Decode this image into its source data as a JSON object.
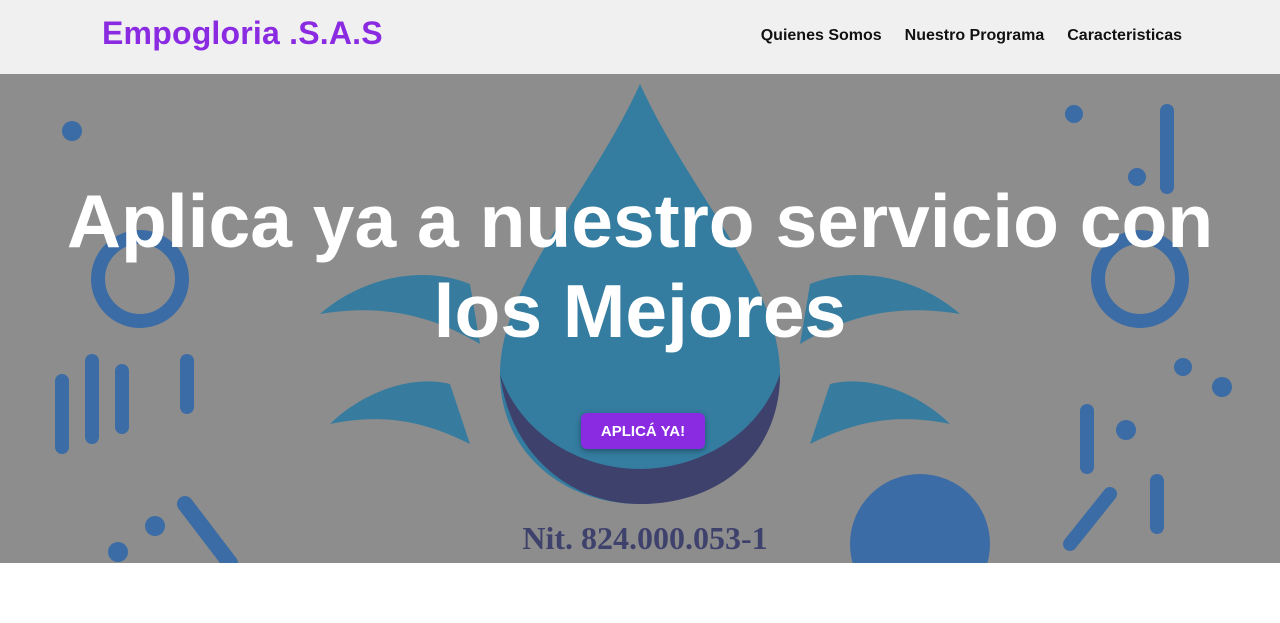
{
  "header": {
    "brand": "Empogloria .S.A.S",
    "nav": [
      {
        "label": "Quienes Somos"
      },
      {
        "label": "Nuestro Programa"
      },
      {
        "label": "Caracteristicas"
      }
    ]
  },
  "hero": {
    "headline_line1": "Aplica ya a nuestro servicio con",
    "headline_line2": "los Mejores",
    "cta_label": "APLICÁ YA!",
    "background_text": "Nit. 824.000.053-1"
  },
  "colors": {
    "accent": "#8a2be2",
    "header_bg": "#f0f0f0"
  }
}
